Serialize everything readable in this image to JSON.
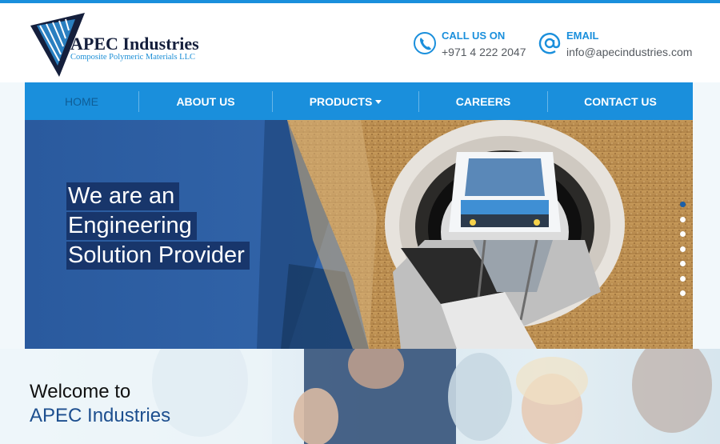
{
  "brand": {
    "name": "APEC Industries",
    "tagline": "Composite Polymeric Materials LLC"
  },
  "contact": {
    "phone_label": "CALL US ON",
    "phone_value": "+971 4 222 2047",
    "email_label": "EMAIL",
    "email_value": "info@apecindustries.com"
  },
  "nav": {
    "items": [
      {
        "label": "HOME",
        "active": true
      },
      {
        "label": "ABOUT US"
      },
      {
        "label": "PRODUCTS",
        "has_dropdown": true
      },
      {
        "label": "CAREERS"
      },
      {
        "label": "CONTACT US"
      }
    ]
  },
  "hero": {
    "slogan_lines": [
      "We are an",
      "Engineering",
      "Solution Provider"
    ],
    "slide_count": 7,
    "active_slide": 1
  },
  "welcome": {
    "line1": "Welcome to",
    "line2": "APEC Industries"
  },
  "colors": {
    "accent": "#1a8fdc",
    "nav_active_text": "#0f5d96",
    "dark_text": "#151f3c",
    "slogan_bg": "#142d5f"
  },
  "icons": {
    "phone": "phone-circle-icon",
    "email": "at-sign-icon",
    "dropdown": "caret-down-icon"
  }
}
